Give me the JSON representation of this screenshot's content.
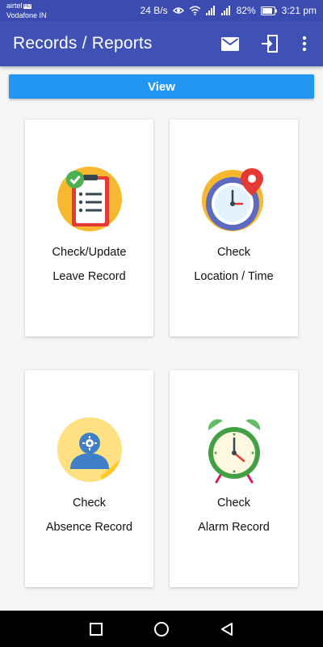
{
  "status_bar": {
    "carrier_primary": "airtel",
    "carrier_badge": "HD",
    "carrier_secondary": "Vodafone IN",
    "network_speed": "24 B/s",
    "battery": "82%",
    "time": "3:21 pm",
    "icons": [
      "eye-icon",
      "wifi-icon",
      "signal-icon",
      "signal-icon",
      "battery-icon"
    ]
  },
  "app_bar": {
    "title": "Records / Reports",
    "actions": [
      "mail-icon",
      "logout-icon",
      "more-vert-icon"
    ]
  },
  "view_button": {
    "label": "View"
  },
  "cards": [
    {
      "line1": "Check/Update",
      "line2": "Leave Record",
      "icon": "leave-record-icon"
    },
    {
      "line1": "Check",
      "line2": "Location / Time",
      "icon": "location-time-icon"
    },
    {
      "line1": "Check",
      "line2": "Absence Record",
      "icon": "absence-record-icon"
    },
    {
      "line1": "Check",
      "line2": "Alarm Record",
      "icon": "alarm-clock-icon"
    }
  ],
  "nav_bar": {
    "buttons": [
      "recents-icon",
      "home-icon",
      "back-icon"
    ]
  },
  "colors": {
    "status_bar": "#3b4bb0",
    "app_bar": "#3f51b5",
    "view_button": "#2196f3",
    "background": "#f5f5f5"
  }
}
